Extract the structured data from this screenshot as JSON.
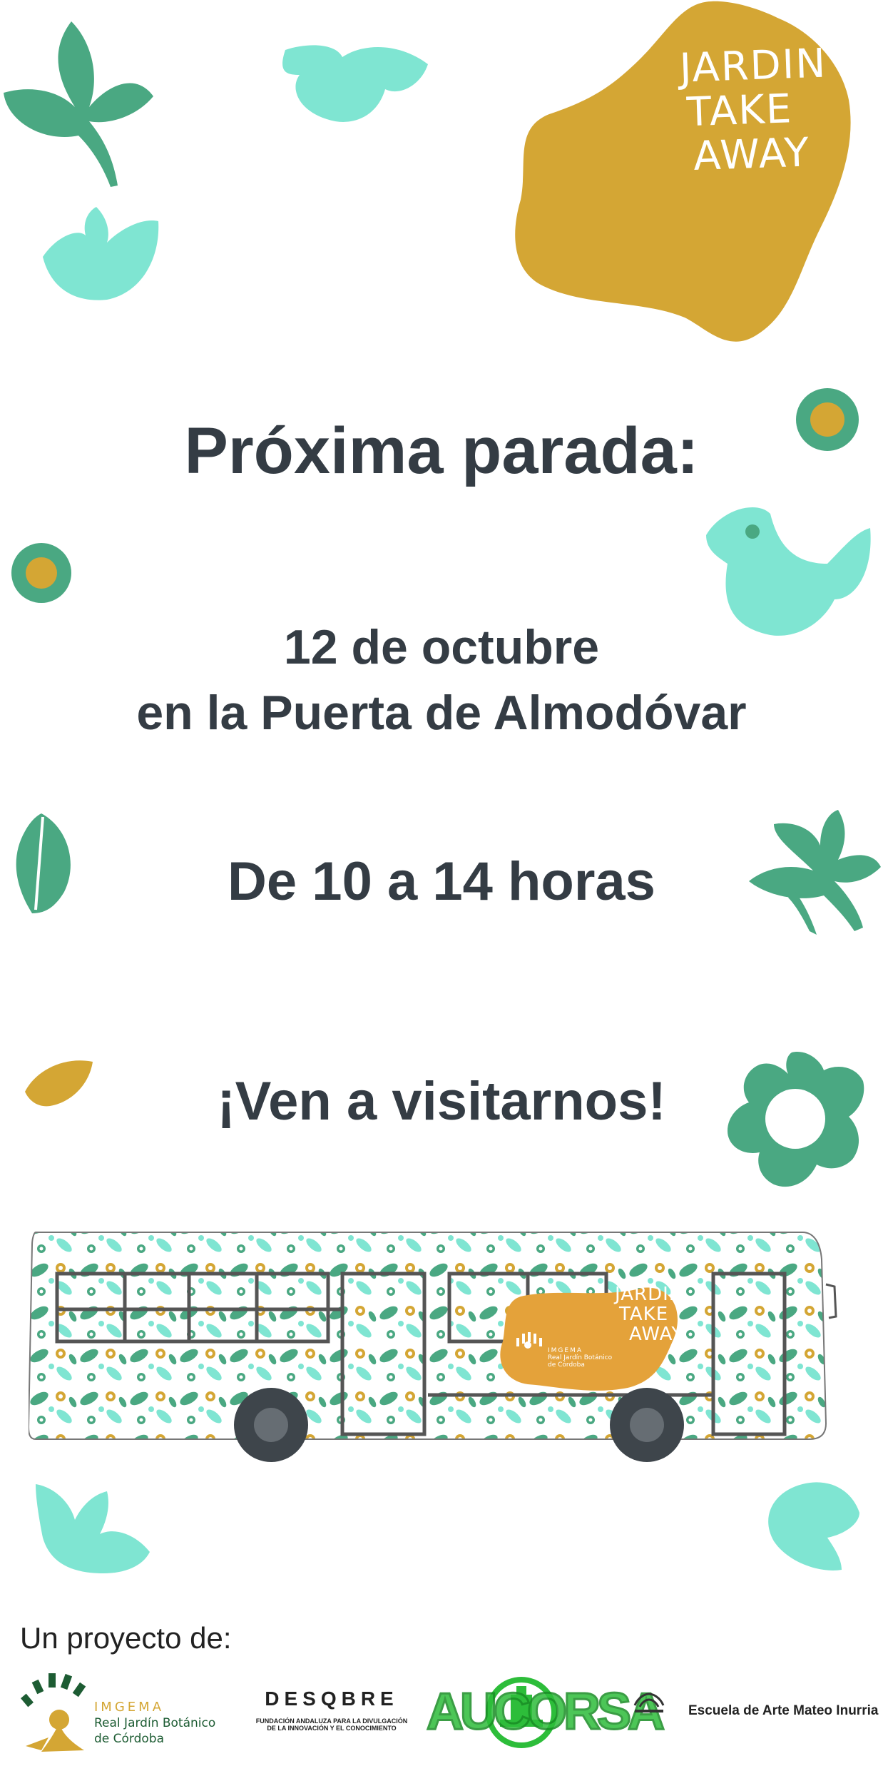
{
  "badge": {
    "line1": "JARDIN",
    "line2": "TAKE",
    "line3": "AWAY"
  },
  "headline": "Próxima parada:",
  "date_line1": "12 de octubre",
  "date_line2": "en la Puerta de Almodóvar",
  "hours": "De 10 a 14 horas",
  "cta": "¡Ven a visitarnos!",
  "bus": {
    "badge_line1": "JARDIN",
    "badge_line2": "TAKE",
    "badge_line3": "AWAY",
    "logo_title": "IMGEMA",
    "logo_sub1": "Real Jardín Botánico",
    "logo_sub2": "de Córdoba"
  },
  "footer": {
    "intro": "Un proyecto de:",
    "imgema_title": "IMGEMA",
    "imgema_sub1": "Real Jardín Botánico",
    "imgema_sub2": "de Córdoba",
    "descubre_name": "DESQBRE",
    "descubre_sub1": "FUNDACIÓN ANDALUZA PARA LA DIVULGACIÓN",
    "descubre_sub2": "DE LA INNOVACIÓN Y EL CONOCIMIENTO",
    "aucorsa": "AUCORSA",
    "escuela": "Escuela de Arte Mateo Inurria"
  },
  "colors": {
    "mint": "#7fe5d2",
    "green": "#4aa882",
    "gold": "#d4a634",
    "text": "#343c44"
  }
}
